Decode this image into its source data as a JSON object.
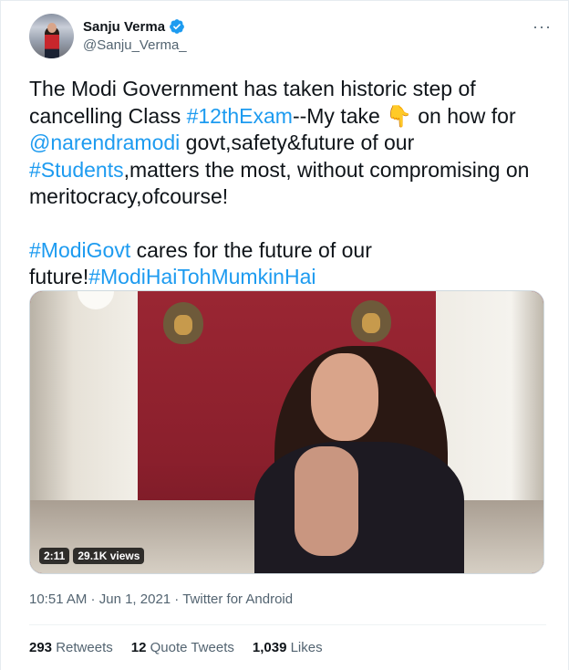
{
  "author": {
    "display_name": "Sanju Verma",
    "handle": "@Sanju_Verma_",
    "verified": true
  },
  "more_button": "···",
  "tweet": {
    "line1_a": "The Modi Government has taken  historic step of cancelling Class ",
    "tag_12th": "#12thExam",
    "line1_b": "--My take ",
    "emoji_point": "👇",
    "line1_c": " on how for ",
    "mention": "@narendramodi",
    "line1_d": " govt,safety&future of our ",
    "tag_students": "#Students",
    "line1_e": ",matters the most, without compromising on meritocracy,ofcourse!",
    "tag_modigovt": "#ModiGovt",
    "line2_a": " cares for the future of our future!",
    "tag_mumkin": "#ModiHaiTohMumkinHai"
  },
  "video": {
    "duration": "2:11",
    "views": "29.1K views"
  },
  "meta": {
    "time": "10:51 AM",
    "sep1": " · ",
    "date": "Jun 1, 2021",
    "sep2": " · ",
    "source": "Twitter for Android"
  },
  "stats": {
    "retweets_count": "293",
    "retweets_label": "Retweets",
    "quotes_count": "12",
    "quotes_label": "Quote Tweets",
    "likes_count": "1,039",
    "likes_label": "Likes"
  },
  "colors": {
    "link": "#1d9bf0",
    "muted": "#536471",
    "text": "#0f1419"
  }
}
